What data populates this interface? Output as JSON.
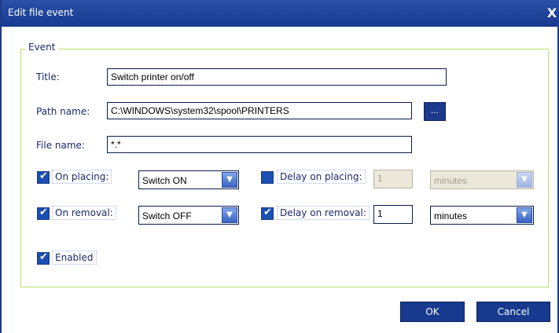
{
  "window": {
    "title": "Edit file event",
    "close_glyph": "X"
  },
  "group": {
    "label": "Event"
  },
  "fields": {
    "title": {
      "label": "Title:",
      "value": "Switch printer on/off"
    },
    "path": {
      "label": "Path name:",
      "value": "C:\\WINDOWS\\system32\\spool\\PRINTERS",
      "browse_label": "..."
    },
    "file": {
      "label": "File name:",
      "value": "*.*"
    }
  },
  "rows": {
    "placing": {
      "checkbox_label": "On placing:",
      "checked": true,
      "action": "Switch ON",
      "delay_label": "Delay on placing:",
      "delay_checked": false,
      "delay_value": "1",
      "delay_unit": "minutes",
      "delay_enabled": false
    },
    "removal": {
      "checkbox_label": "On removal:",
      "checked": true,
      "action": "Switch OFF",
      "delay_label": "Delay on removal:",
      "delay_checked": true,
      "delay_value": "1",
      "delay_unit": "minutes",
      "delay_enabled": true
    }
  },
  "enabled": {
    "label": "Enabled",
    "checked": true
  },
  "buttons": {
    "ok": "OK",
    "cancel": "Cancel"
  },
  "colors": {
    "titlebar": "#1c3a86",
    "group_border": "#b9e06a",
    "control": "#1c4fb3"
  }
}
